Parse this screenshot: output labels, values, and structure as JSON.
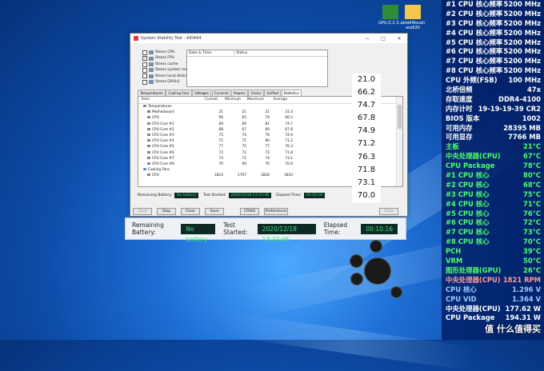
{
  "desktop": {
    "icons": [
      {
        "name": "GPU-Z.2.3...",
        "color": "#2e8b3a"
      },
      {
        "name": "aida64busin ess630",
        "color": "#f2c84b"
      }
    ]
  },
  "window": {
    "title": "System Stability Test - AIDA64",
    "controls": [
      "—",
      "□",
      "✕"
    ],
    "stress_options": [
      {
        "label": "Stress CPU",
        "checked": false
      },
      {
        "label": "Stress FPU",
        "checked": true
      },
      {
        "label": "Stress cache",
        "checked": false
      },
      {
        "label": "Stress system memory",
        "checked": false
      },
      {
        "label": "Stress local disks",
        "checked": false
      },
      {
        "label": "Stress GPU(s)",
        "checked": false
      }
    ],
    "log_columns": [
      "Date & Time",
      "Status"
    ],
    "tabs": [
      "Temperatures",
      "Cooling Fans",
      "Voltages",
      "Currents",
      "Powers",
      "Clocks",
      "Unified",
      "Statistics"
    ],
    "active_tab": "Statistics",
    "grid_columns": [
      "Item",
      "Current",
      "Minimum",
      "Maximum",
      "Average"
    ],
    "grid_rows": [
      {
        "item": "Temperatures",
        "level": 0,
        "icon": "temp",
        "cur": "",
        "min": "",
        "max": "",
        "avg": ""
      },
      {
        "item": "Motherboard",
        "level": 1,
        "icon": "board",
        "cur": "21",
        "min": "21",
        "max": "21",
        "avg": "21.0"
      },
      {
        "item": "CPU",
        "level": 1,
        "icon": "sensor",
        "cur": "66",
        "min": "65",
        "max": "70",
        "avg": "66.2"
      },
      {
        "item": "CPU Core #1",
        "level": 1,
        "icon": "sensor",
        "cur": "69",
        "min": "69",
        "max": "81",
        "avg": "74.7"
      },
      {
        "item": "CPU Core #2",
        "level": 1,
        "icon": "sensor",
        "cur": "68",
        "min": "67",
        "max": "69",
        "avg": "67.8"
      },
      {
        "item": "CPU Core #3",
        "level": 1,
        "icon": "sensor",
        "cur": "75",
        "min": "74",
        "max": "76",
        "avg": "74.9"
      },
      {
        "item": "CPU Core #4",
        "level": 1,
        "icon": "sensor",
        "cur": "71",
        "min": "71",
        "max": "80",
        "avg": "71.2"
      },
      {
        "item": "CPU Core #5",
        "level": 1,
        "icon": "sensor",
        "cur": "77",
        "min": "75",
        "max": "77",
        "avg": "76.3"
      },
      {
        "item": "CPU Core #6",
        "level": 1,
        "icon": "sensor",
        "cur": "72",
        "min": "71",
        "max": "72",
        "avg": "71.8"
      },
      {
        "item": "CPU Core #7",
        "level": 1,
        "icon": "sensor",
        "cur": "73",
        "min": "72",
        "max": "74",
        "avg": "73.1"
      },
      {
        "item": "CPU Core #8",
        "level": 1,
        "icon": "sensor",
        "cur": "70",
        "min": "69",
        "max": "70",
        "avg": "70.0"
      },
      {
        "item": "Cooling Fans",
        "level": 0,
        "icon": "fan",
        "cur": "",
        "min": "",
        "max": "",
        "avg": ""
      },
      {
        "item": "CPU",
        "level": 1,
        "icon": "sensor",
        "cur": "1814",
        "min": "1797",
        "max": "1826",
        "avg": "1810"
      }
    ],
    "status": {
      "remaining_label": "Remaining Battery:",
      "remaining_value": "No battery",
      "started_label": "Test Started:",
      "started_value": "2020/12/18 13:33:46",
      "elapsed_label": "Elapsed Time:",
      "elapsed_value": "00:10:16"
    },
    "buttons": [
      {
        "label": "Start",
        "enabled": false
      },
      {
        "label": "Stop",
        "enabled": true
      },
      {
        "label": "Clear",
        "enabled": true
      },
      {
        "label": "Save",
        "enabled": true
      },
      {
        "label": "CPUID",
        "enabled": true
      },
      {
        "label": "Preferences",
        "enabled": true
      },
      {
        "label": "Close",
        "enabled": false
      }
    ]
  },
  "value_column": [
    "21.0",
    "66.2",
    "74.7",
    "67.8",
    "74.9",
    "71.2",
    "76.3",
    "71.8",
    "73.1",
    "70.0"
  ],
  "zoom_status": {
    "remaining_label": "Remaining Battery:",
    "remaining_value": "No battery",
    "started_label": "Test Started:",
    "started_value": "2020/12/18 13:33:46",
    "elapsed_label": "Elapsed Time:",
    "elapsed_value": "00:10:16"
  },
  "osd": {
    "rows": [
      {
        "label": "#1 CPU 核心频率",
        "value": "5200 MHz",
        "color": "#ffffff"
      },
      {
        "label": "#2 CPU 核心频率",
        "value": "5200 MHz",
        "color": "#ffffff"
      },
      {
        "label": "#3 CPU 核心频率",
        "value": "5200 MHz",
        "color": "#ffffff"
      },
      {
        "label": "#4 CPU 核心频率",
        "value": "5200 MHz",
        "color": "#ffffff"
      },
      {
        "label": "#5 CPU 核心频率",
        "value": "5200 MHz",
        "color": "#ffffff"
      },
      {
        "label": "#6 CPU 核心频率",
        "value": "5200 MHz",
        "color": "#ffffff"
      },
      {
        "label": "#7 CPU 核心频率",
        "value": "5200 MHz",
        "color": "#ffffff"
      },
      {
        "label": "#8 CPU 核心频率",
        "value": "5200 MHz",
        "color": "#ffffff"
      },
      {
        "label": "CPU 外频(FSB)",
        "value": "100 MHz",
        "color": "#ffffff"
      },
      {
        "label": "北桥倍频",
        "value": "47x",
        "color": "#ffffff"
      },
      {
        "label": "存取速度",
        "value": "DDR4-4100",
        "color": "#ffffff"
      },
      {
        "label": "内存计时",
        "value": "19-19-19-39 CR2",
        "color": "#ffffff"
      },
      {
        "label": "BIOS 版本",
        "value": "1002",
        "color": "#ffffff"
      },
      {
        "label": "可用内存",
        "value": "28395 MB",
        "color": "#ffffff"
      },
      {
        "label": "可用显存",
        "value": "7766 MB",
        "color": "#ffffff"
      },
      {
        "label": "主板",
        "value": "21°C",
        "color": "#4cff6a"
      },
      {
        "label": "中央处理器(CPU)",
        "value": "67°C",
        "color": "#4cff6a"
      },
      {
        "label": "CPU Package",
        "value": "78°C",
        "color": "#4cff6a"
      },
      {
        "label": "#1 CPU 核心",
        "value": "80°C",
        "color": "#4cff6a"
      },
      {
        "label": "#2 CPU 核心",
        "value": "68°C",
        "color": "#4cff6a"
      },
      {
        "label": "#3 CPU 核心",
        "value": "75°C",
        "color": "#4cff6a"
      },
      {
        "label": "#4 CPU 核心",
        "value": "71°C",
        "color": "#4cff6a"
      },
      {
        "label": "#5 CPU 核心",
        "value": "76°C",
        "color": "#4cff6a"
      },
      {
        "label": "#6 CPU 核心",
        "value": "72°C",
        "color": "#4cff6a"
      },
      {
        "label": "#7 CPU 核心",
        "value": "73°C",
        "color": "#4cff6a"
      },
      {
        "label": "#8 CPU 核心",
        "value": "70°C",
        "color": "#4cff6a"
      },
      {
        "label": "PCH",
        "value": "39°C",
        "color": "#4cff6a"
      },
      {
        "label": "VRM",
        "value": "50°C",
        "color": "#4cff6a"
      },
      {
        "label": "图形处理器(GPU)",
        "value": "26°C",
        "color": "#4cff6a"
      },
      {
        "label": "中央处理器(CPU)",
        "value": "1821 RPM",
        "color": "#ff9a9a"
      },
      {
        "label": "CPU 核心",
        "value": "1.296 V",
        "color": "#9ec8ff"
      },
      {
        "label": "CPU VID",
        "value": "1.364 V",
        "color": "#9ec8ff"
      },
      {
        "label": "中央处理器(CPU)",
        "value": "177.62 W",
        "color": "#ffffff"
      },
      {
        "label": "CPU Package",
        "value": "194.31 W",
        "color": "#ffffff"
      },
      {
        "label": "",
        "value": "",
        "color": "#ffffff"
      }
    ],
    "watermark": "值 什么值得买"
  }
}
